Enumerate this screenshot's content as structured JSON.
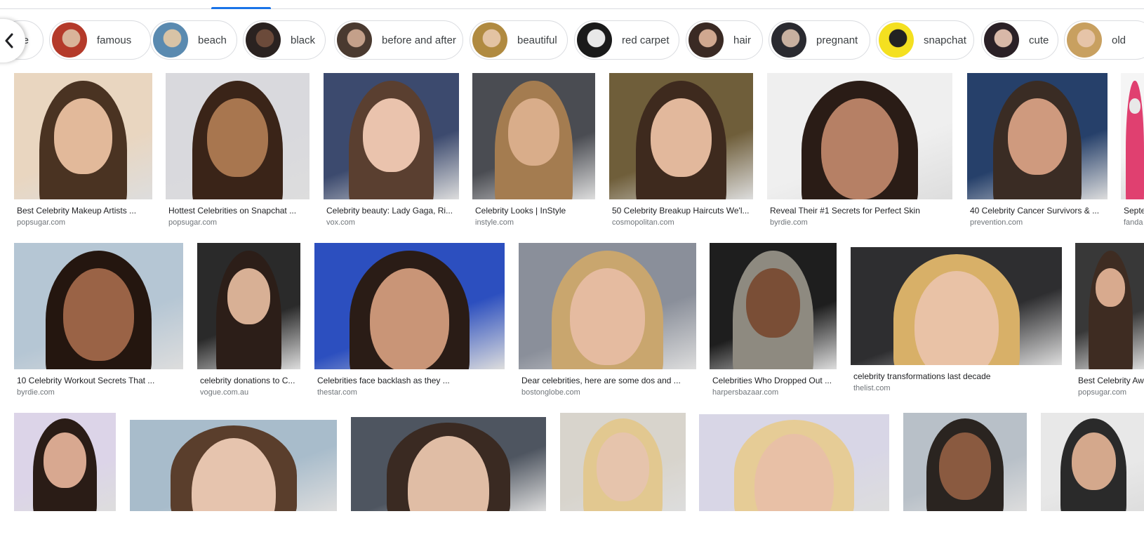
{
  "chips": [
    {
      "label": "e",
      "thumb": [
        "#8a7a6a",
        "#c9a58a"
      ]
    },
    {
      "label": "famous",
      "thumb": [
        "#b43a2a",
        "#d9b49a"
      ]
    },
    {
      "label": "beach",
      "thumb": [
        "#5a8ab0",
        "#d8c3a6"
      ]
    },
    {
      "label": "black",
      "thumb": [
        "#2a2220",
        "#6b4a3a"
      ]
    },
    {
      "label": "before and after",
      "thumb": [
        "#4a3a30",
        "#c4a08a"
      ]
    },
    {
      "label": "beautiful",
      "thumb": [
        "#b08a40",
        "#e3c3a3"
      ]
    },
    {
      "label": "red carpet",
      "thumb": [
        "#1a1a1a",
        "#e8e8e8"
      ]
    },
    {
      "label": "hair",
      "thumb": [
        "#3a2a24",
        "#d0a890"
      ]
    },
    {
      "label": "pregnant",
      "thumb": [
        "#2a2a30",
        "#c8b0a0"
      ]
    },
    {
      "label": "snapchat",
      "thumb": [
        "#f4e020",
        "#222222"
      ]
    },
    {
      "label": "cute",
      "thumb": [
        "#2a2026",
        "#d8b8a8"
      ]
    },
    {
      "label": "old",
      "thumb": [
        "#c8a060",
        "#e6c4a8"
      ]
    }
  ],
  "results": [
    {
      "title": "Best Celebrity Makeup Artists ...",
      "source": "popsugar.com",
      "colors": [
        "#e9d6c0",
        "#4a3322",
        "#e2b99a"
      ]
    },
    {
      "title": "Hottest Celebrities on Snapchat ...",
      "source": "popsugar.com",
      "colors": [
        "#d9d9dd",
        "#3a2418",
        "#a8764f"
      ]
    },
    {
      "title": "Celebrity beauty: Lady Gaga, Ri...",
      "source": "vox.com",
      "colors": [
        "#3c4a6e",
        "#5a3f30",
        "#eac3ad"
      ]
    },
    {
      "title": "Celebrity Looks | InStyle",
      "source": "instyle.com",
      "colors": [
        "#4a4c52",
        "#a47c50",
        "#d9ad8a"
      ]
    },
    {
      "title": "50 Celebrity Breakup Haircuts We'l...",
      "source": "cosmopolitan.com",
      "colors": [
        "#6f5e3a",
        "#3e2a1e",
        "#e2b89c"
      ]
    },
    {
      "title": "Reveal Their #1 Secrets for Perfect Skin",
      "source": "byrdie.com",
      "colors": [
        "#efefef",
        "#2a1c16",
        "#b68065"
      ]
    },
    {
      "title": "40 Celebrity Cancer Survivors & ...",
      "source": "prevention.com",
      "colors": [
        "#26406a",
        "#3a2c24",
        "#cf9a7e"
      ]
    },
    {
      "title": "Septe",
      "source": "fanda",
      "colors": [
        "#f5f5f5",
        "#e04070",
        "#e8e8e8"
      ]
    },
    {
      "title": "10 Celebrity Workout Secrets That ...",
      "source": "byrdie.com",
      "colors": [
        "#b5c6d4",
        "#24160f",
        "#9a6346"
      ]
    },
    {
      "title": "celebrity donations to C...",
      "source": "vogue.com.au",
      "colors": [
        "#2a2a2a",
        "#2c1e18",
        "#d8b095"
      ]
    },
    {
      "title": "Celebrities face backlash as they ...",
      "source": "thestar.com",
      "colors": [
        "#2c4fbf",
        "#2a1c16",
        "#c99577"
      ]
    },
    {
      "title": "Dear celebrities, here are some dos and ...",
      "source": "bostonglobe.com",
      "colors": [
        "#8a8f9a",
        "#c9a66e",
        "#e5bba0"
      ]
    },
    {
      "title": "Celebrities Who Dropped Out ...",
      "source": "harpersbazaar.com",
      "colors": [
        "#1e1e1e",
        "#8e8a80",
        "#7a4e36"
      ]
    },
    {
      "title": "celebrity transformations last decade",
      "source": "thelist.com",
      "colors": [
        "#2e2e30",
        "#d8b068",
        "#e9c2a6"
      ]
    },
    {
      "title": "Best Celebrity Aw",
      "source": "popsugar.com",
      "colors": [
        "#383838",
        "#3e2c22",
        "#d8aa8e"
      ]
    },
    {
      "title": "",
      "source": "",
      "colors": [
        "#dcd4e8",
        "#2a1c16",
        "#d8a890"
      ]
    },
    {
      "title": "",
      "source": "",
      "colors": [
        "#a8bccb",
        "#5a3e2c",
        "#e6c4ae"
      ]
    },
    {
      "title": "",
      "source": "",
      "colors": [
        "#4e5560",
        "#3a2a22",
        "#e0bda5"
      ]
    },
    {
      "title": "",
      "source": "",
      "colors": [
        "#d8d4cc",
        "#e2c890",
        "#e6c4ac"
      ]
    },
    {
      "title": "",
      "source": "",
      "colors": [
        "#d8d6e6",
        "#e6cc96",
        "#e8c0a6"
      ]
    },
    {
      "title": "",
      "source": "",
      "colors": [
        "#b8c0c8",
        "#2a2420",
        "#8a5a40"
      ]
    },
    {
      "title": "",
      "source": "",
      "colors": [
        "#e8e8e8",
        "#2a2a2a",
        "#d4a88c"
      ]
    }
  ],
  "accent": "#1a73e8"
}
